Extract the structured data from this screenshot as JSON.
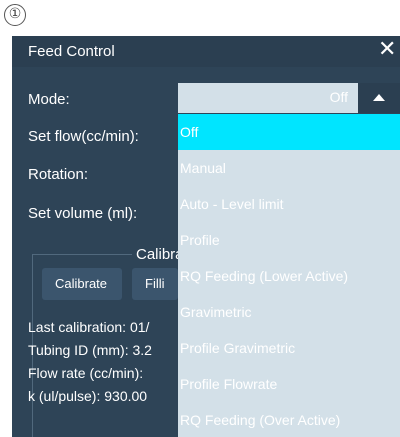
{
  "step_marker": "①",
  "dialog": {
    "title": "Feed Control",
    "close_symbol": "✕"
  },
  "fields": {
    "mode_label": "Mode:",
    "set_flow_label": "Set flow(cc/min):",
    "rotation_label": "Rotation:",
    "set_volume_label": "Set volume (ml):"
  },
  "mode_select": {
    "value": "Off",
    "options": [
      "Off",
      "Manual",
      "Auto - Level limit",
      "Profile",
      "RQ Feeding (Lower Active)",
      "Gravimetric",
      "Profile Gravimetric",
      "Profile Flowrate",
      "RQ Feeding (Over Active)"
    ],
    "selected_index": 0
  },
  "calibration": {
    "group_title": "Calibra",
    "calibrate_button": "Calibrate",
    "fill_button": "Filli",
    "last_calibration": "Last calibration: 01/",
    "tubing_id": "Tubing ID (mm): 3.2",
    "flow_rate": "Flow rate (cc/min):",
    "k_value": "k (ul/pulse): 930.00"
  },
  "colors": {
    "dialog_bg": "#2e4457",
    "titlebar_bg": "#2b3f51",
    "dropdown_bg": "#d3e0e8",
    "selected_option": "#00e5ff",
    "text": "#ffffff"
  }
}
